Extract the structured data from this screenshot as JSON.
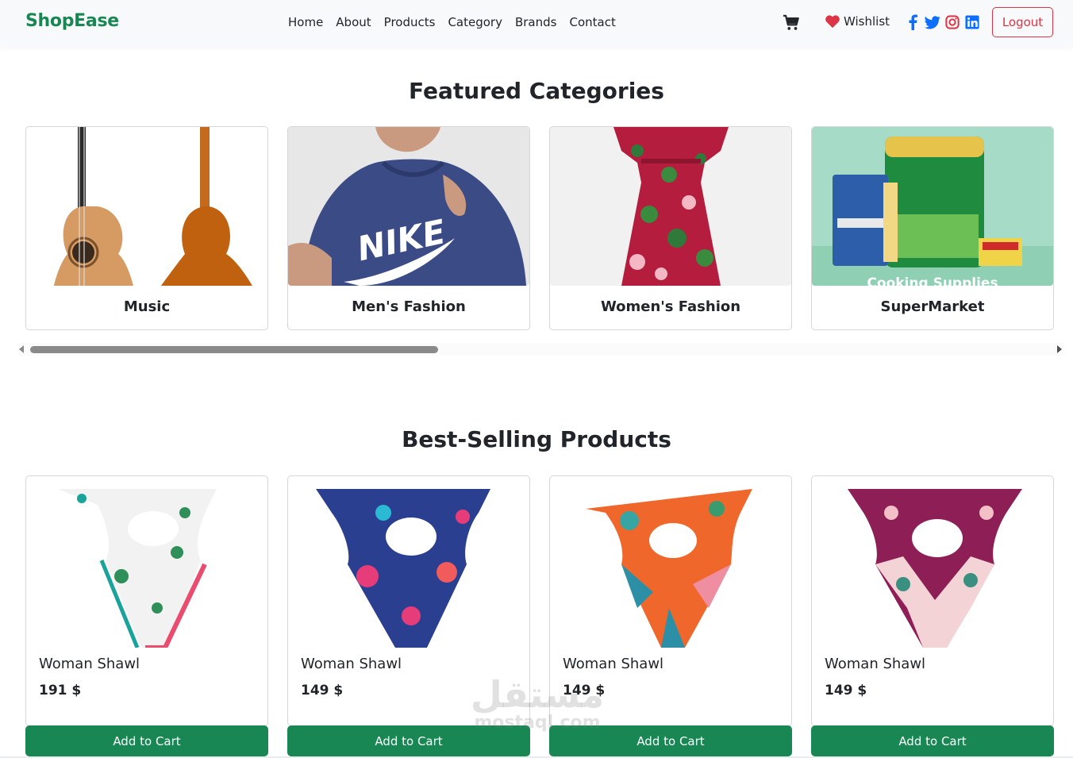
{
  "navbar": {
    "brand": "ShopEase",
    "links": [
      "Home",
      "About",
      "Products",
      "Category",
      "Brands",
      "Contact"
    ],
    "wishlist_label": "Wishlist",
    "logout_label": "Logout",
    "icons": [
      "cart-icon",
      "heart-icon",
      "facebook-icon",
      "twitter-icon",
      "instagram-icon",
      "linkedin-icon"
    ],
    "colors": {
      "brand": "#198754",
      "logout": "#dc3545",
      "heart": "#dc3545",
      "social": "#0d6efd"
    }
  },
  "featured": {
    "title": "Featured Categories",
    "categories": [
      {
        "label": "Music"
      },
      {
        "label": "Men's Fashion"
      },
      {
        "label": "Women's Fashion"
      },
      {
        "label": "SuperMarket",
        "overlay_text": "Cooking Supplies"
      }
    ]
  },
  "best_selling": {
    "title": "Best-Selling Products",
    "products": [
      {
        "name": "Woman Shawl",
        "price": "191 $",
        "button": "Add to Cart"
      },
      {
        "name": "Woman Shawl",
        "price": "149 $",
        "button": "Add to Cart"
      },
      {
        "name": "Woman Shawl",
        "price": "149 $",
        "button": "Add to Cart"
      },
      {
        "name": "Woman Shawl",
        "price": "149 $",
        "button": "Add to Cart"
      }
    ],
    "colors": {
      "button": "#198754"
    }
  },
  "watermark": {
    "arabic": "مستقل",
    "latin": "mostaql.com"
  }
}
